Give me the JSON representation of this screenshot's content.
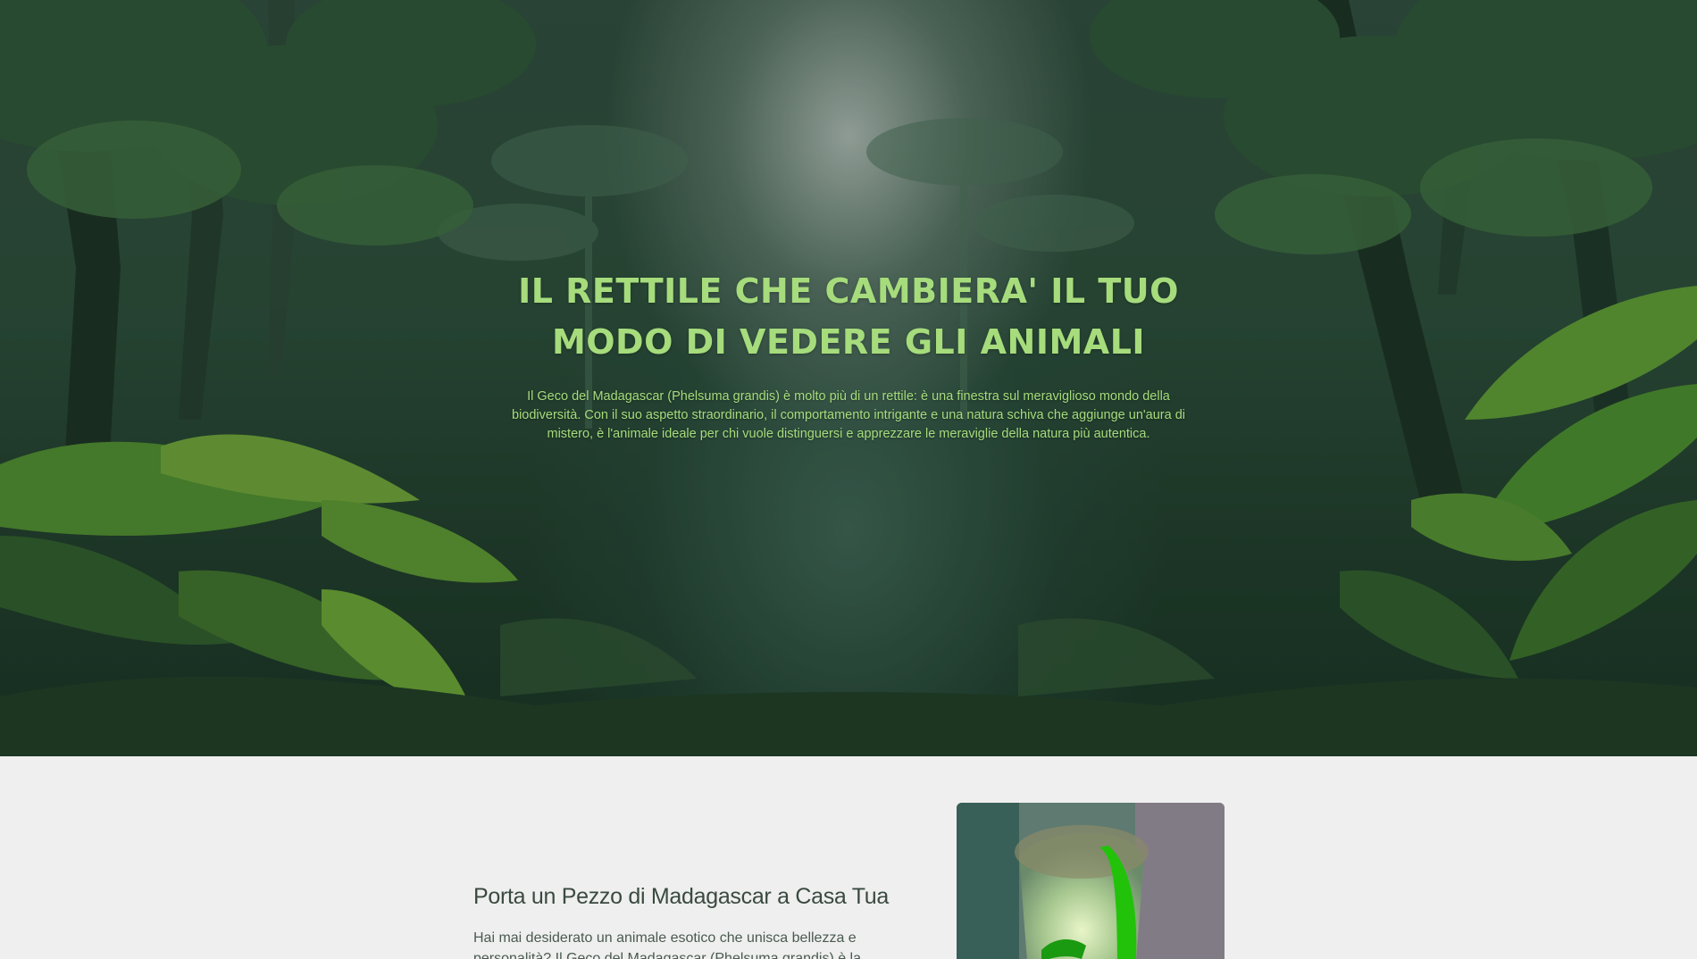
{
  "hero": {
    "title": "IL RETTILE CHE CAMBIERA' IL TUO MODO DI VEDERE GLI ANIMALI",
    "description": "Il Geco del Madagascar (Phelsuma grandis) è molto più di un rettile: è una finestra sul meraviglioso mondo della biodiversità. Con il suo aspetto straordinario, il comportamento intrigante e una natura schiva che aggiunge un'aura di mistero, è l'animale ideale per chi vuole distinguersi e apprezzare le meraviglie della natura più autentica.",
    "title_color": "#a6dc7c"
  },
  "section": {
    "heading": "Porta un Pezzo di Madagascar a Casa Tua",
    "text": "Hai mai desiderato un animale esotico che unisca bellezza e personalità? Il Geco del Madagascar (Phelsuma grandis) è la scelta"
  }
}
